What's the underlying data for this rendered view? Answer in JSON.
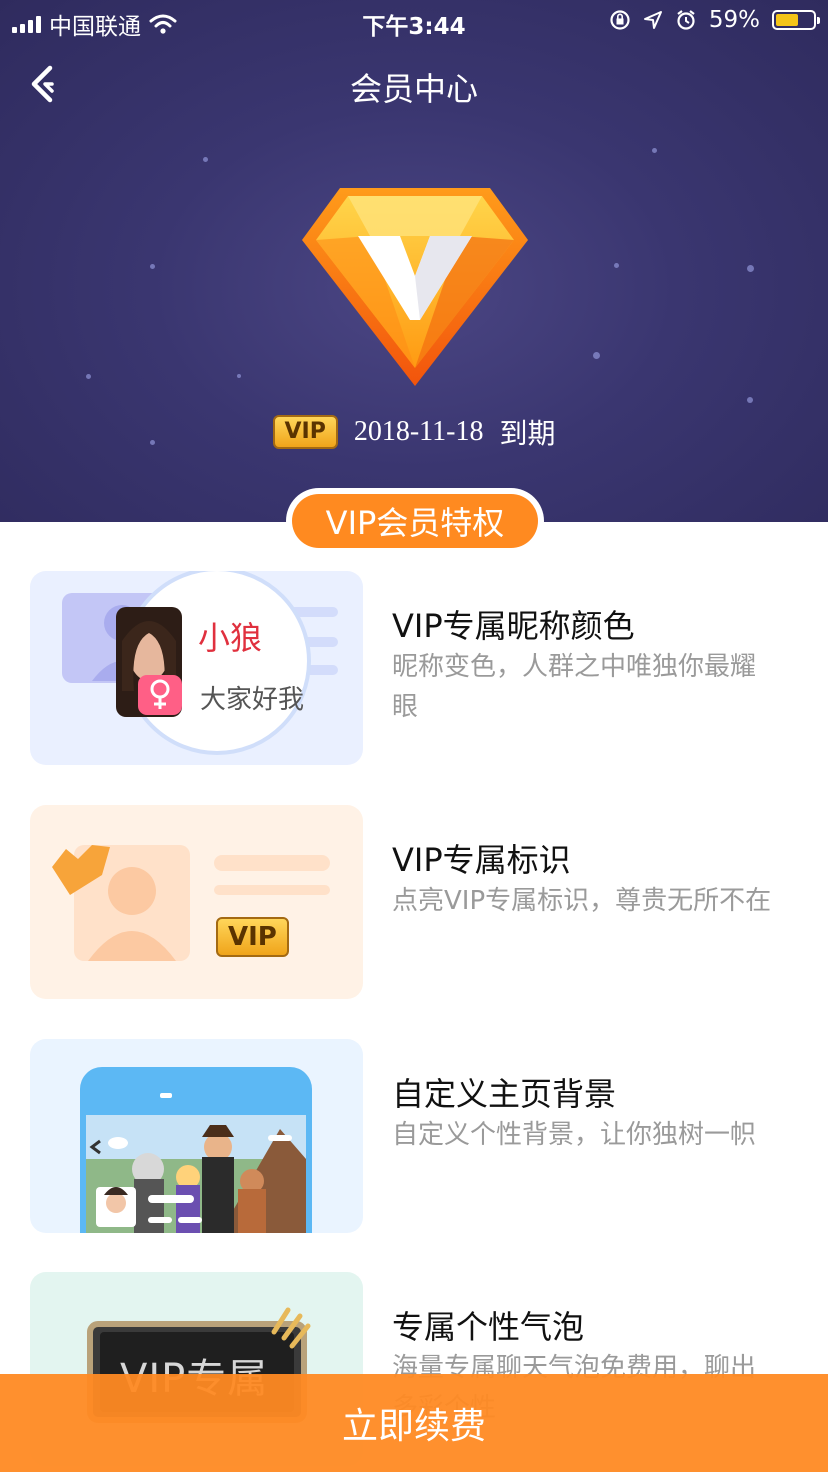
{
  "status_bar": {
    "carrier": "中国联通",
    "time": "下午3:44",
    "battery_percent": "59%",
    "battery_level": 0.59
  },
  "nav": {
    "title": "会员中心"
  },
  "vip": {
    "badge": "VIP",
    "expiry_date": "2018-11-18",
    "expiry_suffix": "到期"
  },
  "section_title": "VIP会员特权",
  "features": [
    {
      "title": "VIP专属昵称颜色",
      "desc": "昵称变色，人群之中唯独你最耀眼",
      "card_bg": "#eaf0ff",
      "illustration": {
        "name": "小狼",
        "greeting": "大家好我"
      }
    },
    {
      "title": "VIP专属标识",
      "desc": "点亮VIP专属标识，尊贵无所不在",
      "card_bg": "#fff2e6",
      "illustration": {
        "badge": "VIP"
      }
    },
    {
      "title": "自定义主页背景",
      "desc": "自定义个性背景，让你独树一帜",
      "card_bg": "#eaf4ff"
    },
    {
      "title": "专属个性气泡",
      "desc": "海量专属聊天气泡免费用，聊出多彩个性",
      "card_bg": "#e3f5f0",
      "illustration": {
        "bubble_text": "VIP专属"
      }
    }
  ],
  "cta": {
    "label": "立即续费"
  },
  "colors": {
    "accent": "#ff8a20",
    "header_bg": "#3a3670"
  }
}
